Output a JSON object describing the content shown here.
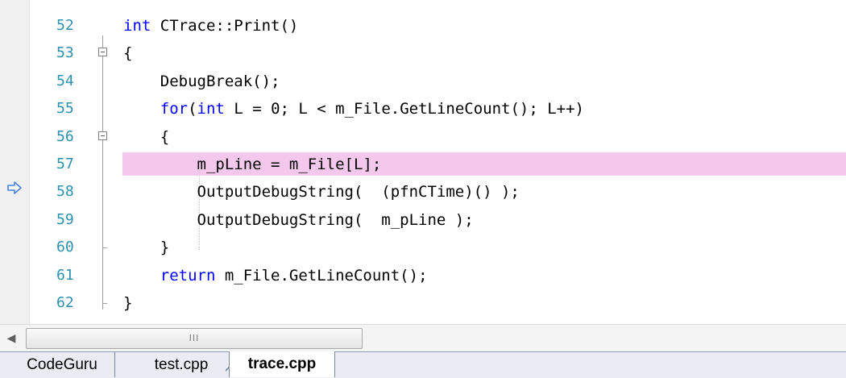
{
  "editor": {
    "current_line": 57,
    "lines": [
      {
        "number": "52",
        "code": [
          {
            "t": "int",
            "kw": true
          },
          {
            "t": " CTrace::Print()"
          }
        ]
      },
      {
        "number": "53",
        "code": [
          {
            "t": "{"
          }
        ]
      },
      {
        "number": "54",
        "code": [
          {
            "t": "    DebugBreak();"
          }
        ]
      },
      {
        "number": "55",
        "code": [
          {
            "t": "    "
          },
          {
            "t": "for",
            "kw": true
          },
          {
            "t": "("
          },
          {
            "t": "int",
            "kw": true
          },
          {
            "t": " L = 0; L < m_File.GetLineCount(); L++)"
          }
        ]
      },
      {
        "number": "56",
        "code": [
          {
            "t": "    {"
          }
        ]
      },
      {
        "number": "57",
        "code": [
          {
            "t": "        m_pLine = m_File[L];"
          }
        ]
      },
      {
        "number": "58",
        "code": [
          {
            "t": "        OutputDebugString(  (pfnCTime)() );"
          }
        ]
      },
      {
        "number": "59",
        "code": [
          {
            "t": "        OutputDebugString(  m_pLine );"
          }
        ]
      },
      {
        "number": "60",
        "code": [
          {
            "t": "    }"
          }
        ]
      },
      {
        "number": "61",
        "code": [
          {
            "t": "    "
          },
          {
            "t": "return",
            "kw": true
          },
          {
            "t": " m_File.GetLineCount();"
          }
        ]
      },
      {
        "number": "62",
        "code": [
          {
            "t": "}"
          }
        ]
      }
    ]
  },
  "scrollbar": {
    "grip": "III"
  },
  "tabs": [
    {
      "label": "CodeGuru",
      "active": false
    },
    {
      "label": "test.cpp",
      "active": false
    },
    {
      "label": "trace.cpp",
      "active": true
    }
  ],
  "colors": {
    "line_number": "#2b91af",
    "keyword": "#0000ff",
    "current_line_highlight": "#f4c8ec",
    "execution_arrow": "#4a7fe0"
  }
}
